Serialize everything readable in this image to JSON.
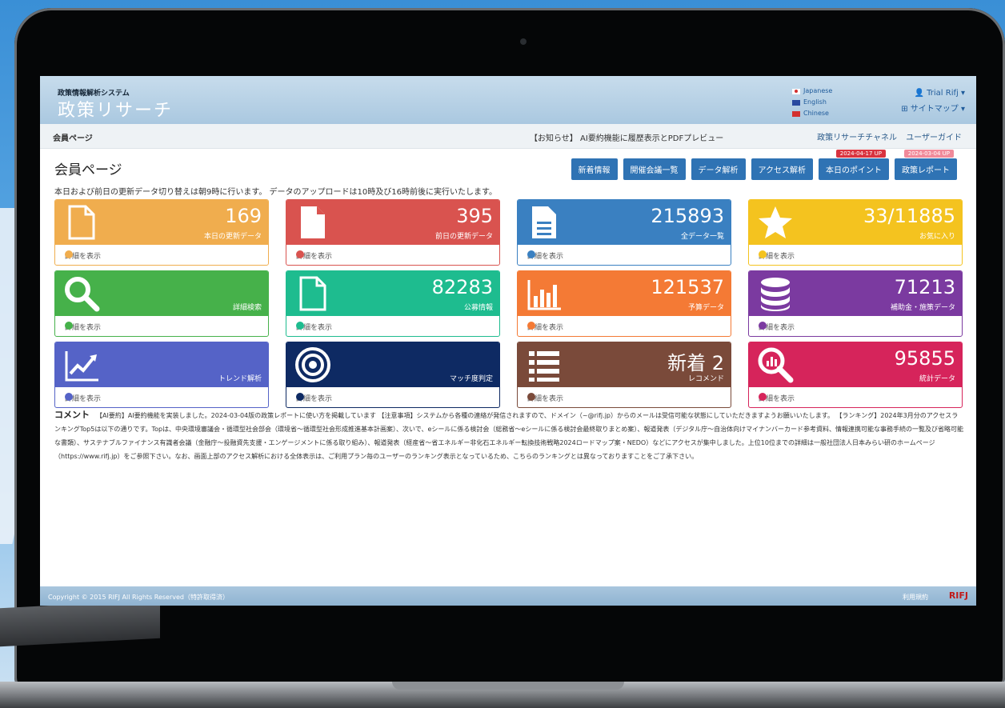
{
  "header": {
    "system_sub": "政策情報解析システム",
    "system_title": "政策リサーチ",
    "languages": [
      {
        "name": "Japanese",
        "color": "#ffffff"
      },
      {
        "name": "English",
        "color": "#2a4aa0"
      },
      {
        "name": "Chinese",
        "color": "#d32f2f"
      }
    ],
    "user": "Trial Rifj",
    "sitemap": "サイトマップ"
  },
  "navbar": {
    "member_page": "会員ページ",
    "notice": "【お知らせ】 AI要約機能に履歴表示とPDFプレビュー",
    "links": [
      "政策リサーチチャネル",
      "ユーザーガイド"
    ]
  },
  "page": {
    "title": "会員ページ",
    "update_notice": "本日および前日の更新データ切り替えは朝9時に行います。 データのアップロードは10時及び16時前後に実行いたします。"
  },
  "buttons": [
    {
      "label": "新着情報"
    },
    {
      "label": "開催会議一覧"
    },
    {
      "label": "データ解析"
    },
    {
      "label": "アクセス解析"
    },
    {
      "label": "本日のポイント",
      "badge": "2024-04-17 UP"
    },
    {
      "label": "政策レポート",
      "badge": "2024-03-04 UP"
    }
  ],
  "tiles": [
    {
      "num": "169",
      "label": "本日の更新データ",
      "icon": "document-outline-icon",
      "color": "#f0ad4e",
      "link": "詳細を表示"
    },
    {
      "num": "395",
      "label": "前日の更新データ",
      "icon": "document-solid-icon",
      "color": "#d9534f",
      "link": "詳細を表示"
    },
    {
      "num": "215893",
      "label": "全データ一覧",
      "icon": "document-text-icon",
      "color": "#3a80c1",
      "link": "詳細を表示"
    },
    {
      "num": "33/11885",
      "label": "お気に入り",
      "icon": "star-icon",
      "color": "#f4c31f",
      "link": "詳細を表示"
    },
    {
      "num": "",
      "label": "詳細検索",
      "icon": "search-icon",
      "color": "#46b14a",
      "link": "詳細を表示"
    },
    {
      "num": "82283",
      "label": "公募情報",
      "icon": "file-outline-icon",
      "color": "#1ebc8f",
      "link": "詳細を表示"
    },
    {
      "num": "121537",
      "label": "予算データ",
      "icon": "bar-chart-icon",
      "color": "#f47a35",
      "link": "詳細を表示"
    },
    {
      "num": "71213",
      "label": "補助金・施策データ",
      "icon": "database-icon",
      "color": "#7b3aa0",
      "link": "詳細を表示"
    },
    {
      "num": "",
      "label": "トレンド解析",
      "icon": "trend-chart-icon",
      "color": "#5563c7",
      "link": "詳細を表示"
    },
    {
      "num": "",
      "label": "マッチ度判定",
      "icon": "target-icon",
      "color": "#0e2a63",
      "link": "詳細を表示"
    },
    {
      "num": "新着 2",
      "label": "レコメンド",
      "icon": "list-icon",
      "color": "#7a4a3a",
      "link": "詳細を表示"
    },
    {
      "num": "95855",
      "label": "統計データ",
      "icon": "stat-search-icon",
      "color": "#d6245b",
      "link": "詳細を表示"
    }
  ],
  "comment": {
    "heading": "コメント",
    "text": "【AI要約】AI要約機能を実装しました。2024-03-04版の政策レポートに使い方を掲載しています 【注意事項】システムから各種の連絡が発信されますので、ドメイン（~@rifj.jp）からのメールは受信可能な状態にしていただきますようお願いいたします。 【ランキング】2024年3月分のアクセスランキングTop5は以下の通りです。Topは、中央環境審議会・循環型社会部会（環境省～循環型社会形成推進基本計画案）、次いで、eシールに係る検討会（総務省～eシールに係る検討会最終取りまとめ案）、報道発表（デジタル庁～自治体向けマイナンバーカード参考資料、情報連携可能な事務手続の一覧及び省略可能な書類）、サステナブルファイナンス有識者会議（金融庁～投融資先支援・エンゲージメントに係る取り組み）、報道発表（経産省～省エネルギー非化石エネルギー転換技術戦略2024ロードマップ案・NEDO）などにアクセスが集中しました。上位10位までの詳細は一般社団法人日本みらい研のホームページ（https://www.rifj.jp）をご参照下さい。なお、画面上部のアクセス解析における全体表示は、ご利用プラン毎のユーザーのランキング表示となっているため、こちらのランキングとは異なっておりますことをご了承下さい。"
  },
  "footer": {
    "copyright": "Copyright © 2015 RIFJ All Rights Reserved（特許取得済）",
    "terms": "利用規約",
    "logo": "RIFJ"
  }
}
